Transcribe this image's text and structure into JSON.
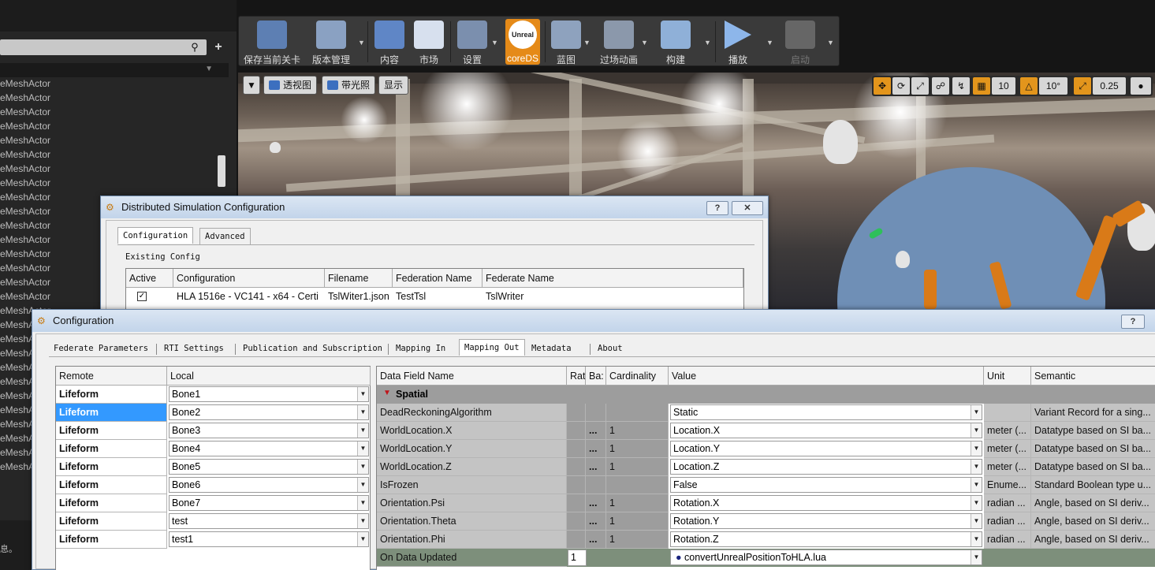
{
  "outliner": {
    "actors": [
      "eMeshActor",
      "eMeshActor",
      "eMeshActor",
      "eMeshActor",
      "eMeshActor",
      "eMeshActor",
      "eMeshActor",
      "eMeshActor",
      "eMeshActor",
      "eMeshActor",
      "eMeshActor",
      "eMeshActor",
      "eMeshActor",
      "eMeshActor",
      "eMeshActor",
      "eMeshActor",
      "eMeshActor",
      "eMeshAc",
      "eMeshA",
      "eMeshA",
      "eMeshA",
      "eMeshA",
      "eMeshA",
      "eMeshA",
      "eMeshA",
      "eMeshA",
      "eMeshA",
      "eMeshA"
    ],
    "status_text": "息。"
  },
  "toolbar": {
    "save": "保存当前关卡",
    "source_control": "版本管理",
    "content": "内容",
    "market": "市场",
    "settings": "设置",
    "coreds_icon": "Unreal",
    "coreds": "coreDS",
    "blueprint": "蓝图",
    "cinematics": "过场动画",
    "build": "构建",
    "play": "播放",
    "launch": "启动"
  },
  "viewport": {
    "perspective": "透视图",
    "lit": "带光照",
    "show": "显示",
    "grid_snap": "10",
    "rotation_snap": "10°",
    "scale_snap": "0.25"
  },
  "dsc_window": {
    "title": "Distributed Simulation Configuration",
    "help": "?",
    "close": "✕",
    "tabs": [
      "Configuration",
      "Advanced"
    ],
    "existing_config_label": "Existing Config",
    "columns": [
      "Active",
      "Configuration",
      "Filename",
      "Federation Name",
      "Federate Name"
    ],
    "row": {
      "configuration": "HLA 1516e - VC141 - x64 - Certi",
      "filename": "TslWiter1.json",
      "federation": "TestTsl",
      "federate": "TslWriter"
    }
  },
  "config_window": {
    "title": "Configuration",
    "help": "?",
    "tabs": [
      "Federate Parameters",
      "RTI Settings",
      "Publication and Subscription",
      "Mapping In",
      "Mapping Out",
      "Metadata",
      "About"
    ],
    "left_table": {
      "columns": [
        "Remote",
        "Local"
      ],
      "rows": [
        {
          "remote": "Lifeform",
          "local": "Bone1"
        },
        {
          "remote": "Lifeform",
          "local": "Bone2"
        },
        {
          "remote": "Lifeform",
          "local": "Bone3"
        },
        {
          "remote": "Lifeform",
          "local": "Bone4"
        },
        {
          "remote": "Lifeform",
          "local": "Bone5"
        },
        {
          "remote": "Lifeform",
          "local": "Bone6"
        },
        {
          "remote": "Lifeform",
          "local": "Bone7"
        },
        {
          "remote": "Lifeform",
          "local": "test"
        },
        {
          "remote": "Lifeform",
          "local": "test1"
        }
      ]
    },
    "right_table": {
      "columns": [
        "Data Field Name",
        "Rat",
        "Ba:",
        "Cardinality",
        "Value",
        "Unit",
        "Semantic"
      ],
      "group": "Spatial",
      "rows": [
        {
          "name": "DeadReckoningAlgorithm",
          "ba": "",
          "card": "",
          "value": "Static",
          "unit": "",
          "semantic": "Variant Record for a sing..."
        },
        {
          "name": "WorldLocation.X",
          "ba": "...",
          "card": "1",
          "value": "Location.X",
          "unit": "meter (...",
          "semantic": "Datatype based on SI ba..."
        },
        {
          "name": "WorldLocation.Y",
          "ba": "...",
          "card": "1",
          "value": "Location.Y",
          "unit": "meter (...",
          "semantic": "Datatype based on SI ba..."
        },
        {
          "name": "WorldLocation.Z",
          "ba": "...",
          "card": "1",
          "value": "Location.Z",
          "unit": "meter (...",
          "semantic": "Datatype based on SI ba..."
        },
        {
          "name": "IsFrozen",
          "ba": "",
          "card": "",
          "value": "False",
          "unit": "Enume...",
          "semantic": "Standard Boolean type u..."
        },
        {
          "name": "Orientation.Psi",
          "ba": "...",
          "card": "1",
          "value": "Rotation.X",
          "unit": "radian ...",
          "semantic": "Angle, based on SI deriv..."
        },
        {
          "name": "Orientation.Theta",
          "ba": "...",
          "card": "1",
          "value": "Rotation.Y",
          "unit": "radian ...",
          "semantic": "Angle, based on SI deriv..."
        },
        {
          "name": "Orientation.Phi",
          "ba": "...",
          "card": "1",
          "value": "Rotation.Z",
          "unit": "radian ...",
          "semantic": "Angle, based on SI deriv..."
        }
      ],
      "on_update": {
        "name": "On Data Updated",
        "rate": "1",
        "value": "convertUnrealPositionToHLA.lua"
      }
    }
  }
}
